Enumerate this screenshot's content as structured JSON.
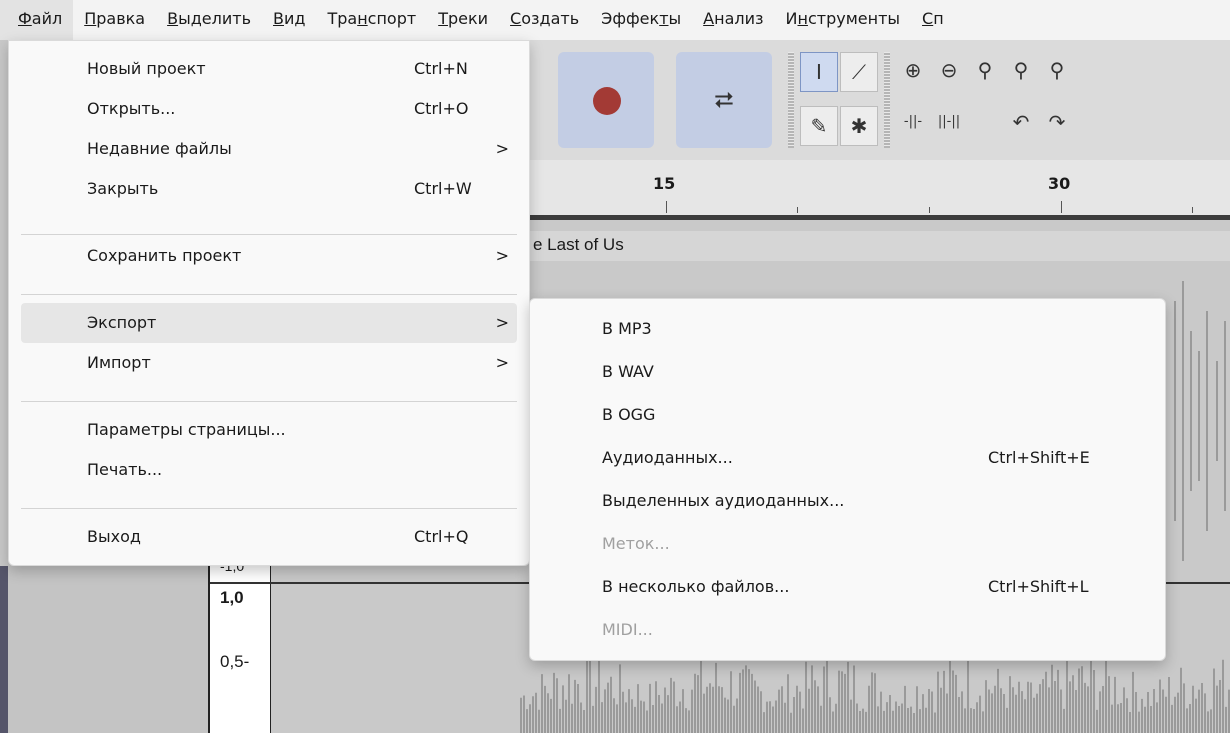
{
  "menubar": [
    {
      "pre": "",
      "key": "Ф",
      "post": "айл"
    },
    {
      "pre": "",
      "key": "П",
      "post": "равка"
    },
    {
      "pre": "",
      "key": "В",
      "post": "ыделить"
    },
    {
      "pre": "",
      "key": "В",
      "post": "ид"
    },
    {
      "pre": "Тра",
      "key": "н",
      "post": "спорт"
    },
    {
      "pre": "",
      "key": "Т",
      "post": "реки"
    },
    {
      "pre": "",
      "key": "С",
      "post": "оздать"
    },
    {
      "pre": "Эффек",
      "key": "т",
      "post": "ы"
    },
    {
      "pre": "",
      "key": "А",
      "post": "нализ"
    },
    {
      "pre": "И",
      "key": "н",
      "post": "струменты"
    },
    {
      "pre": "",
      "key": "С",
      "post": "п"
    }
  ],
  "file_menu": {
    "items": [
      {
        "label": "Новый проект",
        "shortcut": "Ctrl+N",
        "arrow": ""
      },
      {
        "label": "Открыть...",
        "shortcut": "Ctrl+O",
        "arrow": ""
      },
      {
        "label": "Недавние файлы",
        "shortcut": "",
        "arrow": ">"
      },
      {
        "label": "Закрыть",
        "shortcut": "Ctrl+W",
        "arrow": ""
      },
      {
        "label": "Сохранить проект",
        "shortcut": "",
        "arrow": ">"
      },
      {
        "label": "Экспорт",
        "shortcut": "",
        "arrow": ">"
      },
      {
        "label": "Импорт",
        "shortcut": "",
        "arrow": ">"
      },
      {
        "label": "Параметры страницы...",
        "shortcut": "",
        "arrow": ""
      },
      {
        "label": "Печать...",
        "shortcut": "",
        "arrow": ""
      },
      {
        "label": "Выход",
        "shortcut": "Ctrl+Q",
        "arrow": ""
      }
    ],
    "highlighted": "Экспорт"
  },
  "export_menu": {
    "items": [
      {
        "label": "В MP3",
        "shortcut": "",
        "disabled": false
      },
      {
        "label": "В WAV",
        "shortcut": "",
        "disabled": false
      },
      {
        "label": "В OGG",
        "shortcut": "",
        "disabled": false
      },
      {
        "label": "Аудиоданных...",
        "shortcut": "Ctrl+Shift+E",
        "disabled": false
      },
      {
        "label": "Выделенных аудиоданных...",
        "shortcut": "",
        "disabled": false
      },
      {
        "label": "Меток...",
        "shortcut": "",
        "disabled": true
      },
      {
        "label": "В несколько файлов...",
        "shortcut": "Ctrl+Shift+L",
        "disabled": false
      },
      {
        "label": "MIDI...",
        "shortcut": "",
        "disabled": true
      }
    ]
  },
  "toolbar": {
    "record_icon": "record-icon",
    "loop_icon": "loop-icon",
    "tools": [
      "selection-tool-icon",
      "envelope-tool-icon",
      "draw-tool-icon",
      "multi-tool-icon"
    ],
    "zoom": [
      "zoom-in-icon",
      "zoom-out-icon",
      "fit-selection-icon",
      "fit-project-icon",
      "zoom-toggle-icon",
      "trim-icon",
      "silence-icon",
      "undo-icon",
      "redo-icon"
    ]
  },
  "ruler": {
    "labels": [
      "15",
      "30"
    ]
  },
  "track": {
    "title": "e Last of Us",
    "scale_top_partial": "-1,0",
    "scale_labels": [
      "1,0",
      "0,5-"
    ]
  },
  "colors": {
    "menu_bg": "#f9f9f9",
    "highlight": "#e6e6e6",
    "record": "#a33a35",
    "button_bg": "#c3cde4",
    "waveform": "#6b6b6b",
    "app_bg": "#c9c9c9"
  }
}
